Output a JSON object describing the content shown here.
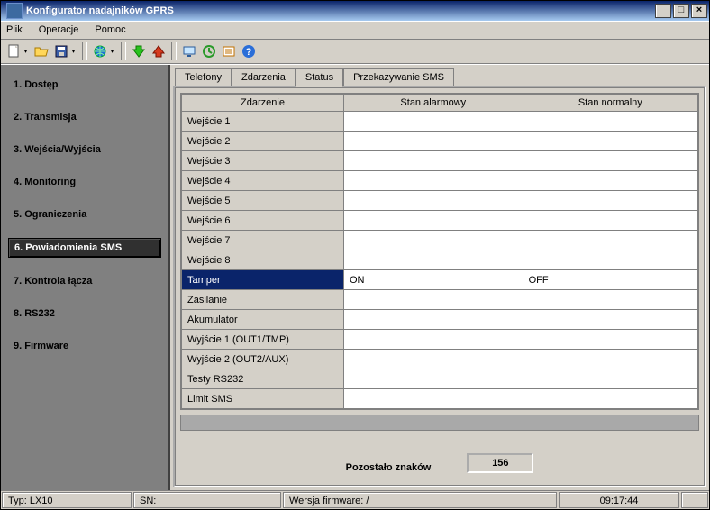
{
  "window": {
    "title": "Konfigurator nadajników GPRS"
  },
  "menu": {
    "file": "Plik",
    "operations": "Operacje",
    "help": "Pomoc"
  },
  "sidebar": {
    "items": [
      {
        "label": "1. Dostęp"
      },
      {
        "label": "2. Transmisja"
      },
      {
        "label": "3. Wejścia/Wyjścia"
      },
      {
        "label": "4. Monitoring"
      },
      {
        "label": "5. Ograniczenia"
      },
      {
        "label": "6. Powiadomienia SMS"
      },
      {
        "label": "7. Kontrola łącza"
      },
      {
        "label": "8. RS232"
      },
      {
        "label": "9. Firmware"
      }
    ],
    "active_index": 5
  },
  "tabs": {
    "items": [
      {
        "label": "Telefony"
      },
      {
        "label": "Zdarzenia"
      },
      {
        "label": "Status"
      },
      {
        "label": "Przekazywanie SMS"
      }
    ],
    "active_index": 2
  },
  "grid": {
    "headers": {
      "event": "Zdarzenie",
      "alarm": "Stan alarmowy",
      "normal": "Stan normalny"
    },
    "rows": [
      {
        "name": "Wejście 1",
        "alarm": "",
        "normal": ""
      },
      {
        "name": "Wejście 2",
        "alarm": "",
        "normal": ""
      },
      {
        "name": "Wejście 3",
        "alarm": "",
        "normal": ""
      },
      {
        "name": "Wejście 4",
        "alarm": "",
        "normal": ""
      },
      {
        "name": "Wejście 5",
        "alarm": "",
        "normal": ""
      },
      {
        "name": "Wejście 6",
        "alarm": "",
        "normal": ""
      },
      {
        "name": "Wejście 7",
        "alarm": "",
        "normal": ""
      },
      {
        "name": "Wejście 8",
        "alarm": "",
        "normal": ""
      },
      {
        "name": "Tamper",
        "alarm": "ON",
        "normal": "OFF"
      },
      {
        "name": "Zasilanie",
        "alarm": "",
        "normal": ""
      },
      {
        "name": "Akumulator",
        "alarm": "",
        "normal": ""
      },
      {
        "name": "Wyjście 1 (OUT1/TMP)",
        "alarm": "",
        "normal": ""
      },
      {
        "name": "Wyjście 2 (OUT2/AUX)",
        "alarm": "",
        "normal": ""
      },
      {
        "name": "Testy RS232",
        "alarm": "",
        "normal": ""
      },
      {
        "name": "Limit SMS",
        "alarm": "",
        "normal": ""
      }
    ],
    "selected_index": 8
  },
  "footer": {
    "chars_label": "Pozostało znaków",
    "chars_value": "156"
  },
  "status": {
    "type_label": "Typ: LX10",
    "sn_label": "SN:",
    "fw_label": "Wersja firmware: /",
    "clock": "09:17:44"
  }
}
